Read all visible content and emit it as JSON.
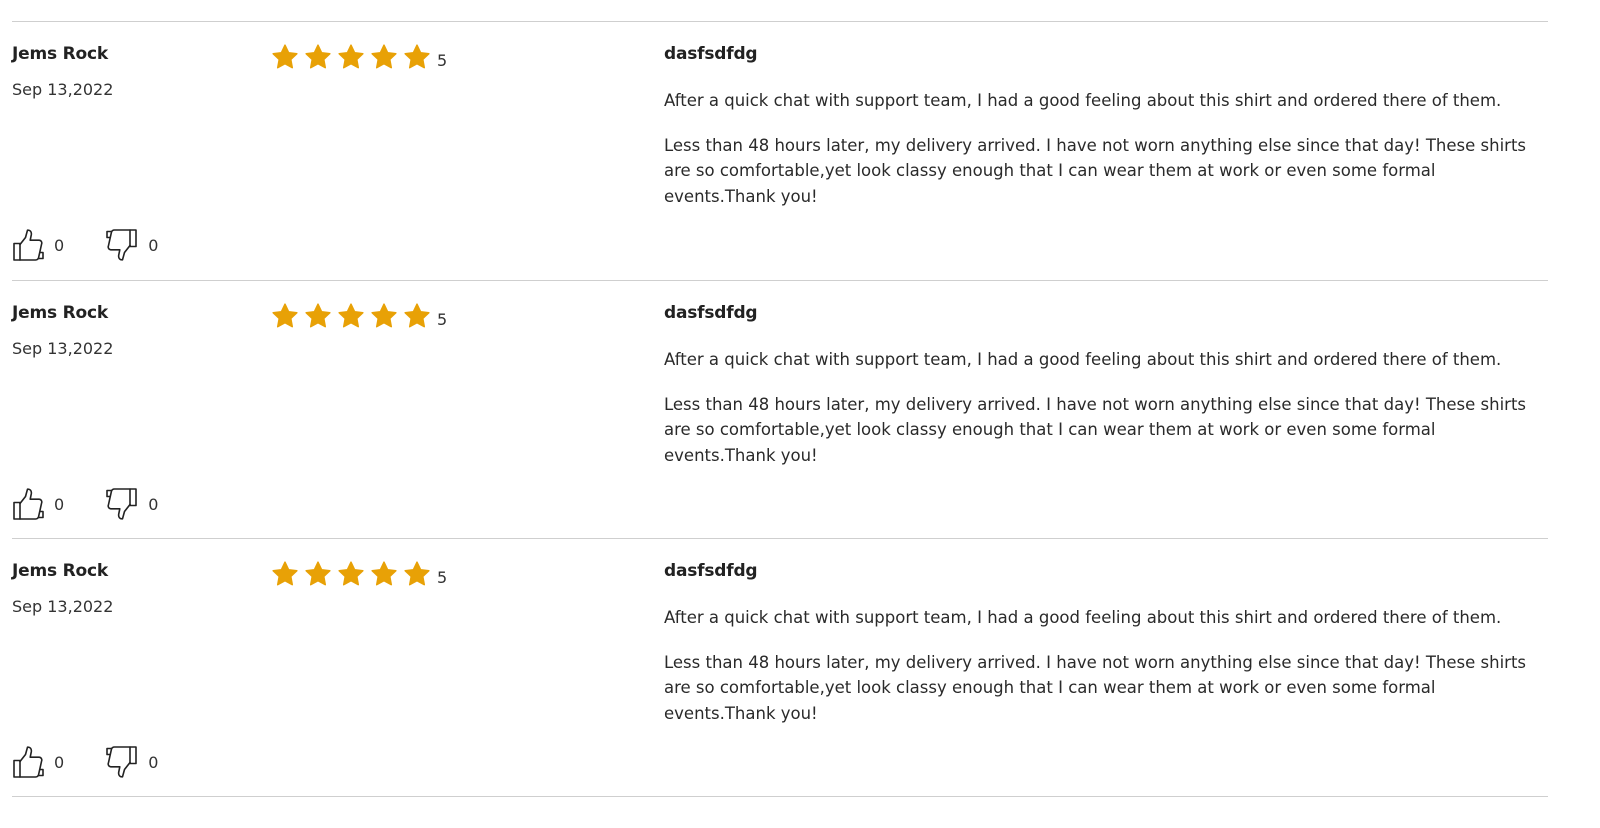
{
  "colors": {
    "star": "#E8A106",
    "divider": "#CFCFCF",
    "text": "#222222"
  },
  "icons": {
    "star": "star-icon",
    "like": "thumbs-up-icon",
    "dislike": "thumbs-down-icon"
  },
  "reviews": [
    {
      "author": "Jems Rock",
      "date": "Sep 13,2022",
      "rating": "5",
      "stars_filled": 5,
      "title": "dasfsdfdg",
      "paragraphs": [
        "After a quick chat with support team, I had a good feeling about this shirt and ordered there of them.",
        "Less than 48 hours later, my delivery arrived. I have not worn anything else since that day! These shirts are so comfortable,yet look classy enough that I can wear them at work or even some formal events.Thank you!"
      ],
      "likes": "0",
      "dislikes": "0"
    },
    {
      "author": "Jems Rock",
      "date": "Sep 13,2022",
      "rating": "5",
      "stars_filled": 5,
      "title": "dasfsdfdg",
      "paragraphs": [
        "After a quick chat with support team, I had a good feeling about this shirt and ordered there of them.",
        "Less than 48 hours later, my delivery arrived. I have not worn anything else since that day! These shirts are so comfortable,yet look classy enough that I can wear them at work or even some formal events.Thank you!"
      ],
      "likes": "0",
      "dislikes": "0"
    },
    {
      "author": "Jems Rock",
      "date": "Sep 13,2022",
      "rating": "5",
      "stars_filled": 5,
      "title": "dasfsdfdg",
      "paragraphs": [
        "After a quick chat with support team, I had a good feeling about this shirt and ordered there of them.",
        "Less than 48 hours later, my delivery arrived. I have not worn anything else since that day! These shirts are so comfortable,yet look classy enough that I can wear them at work or even some formal events.Thank you!"
      ],
      "likes": "0",
      "dislikes": "0"
    }
  ]
}
